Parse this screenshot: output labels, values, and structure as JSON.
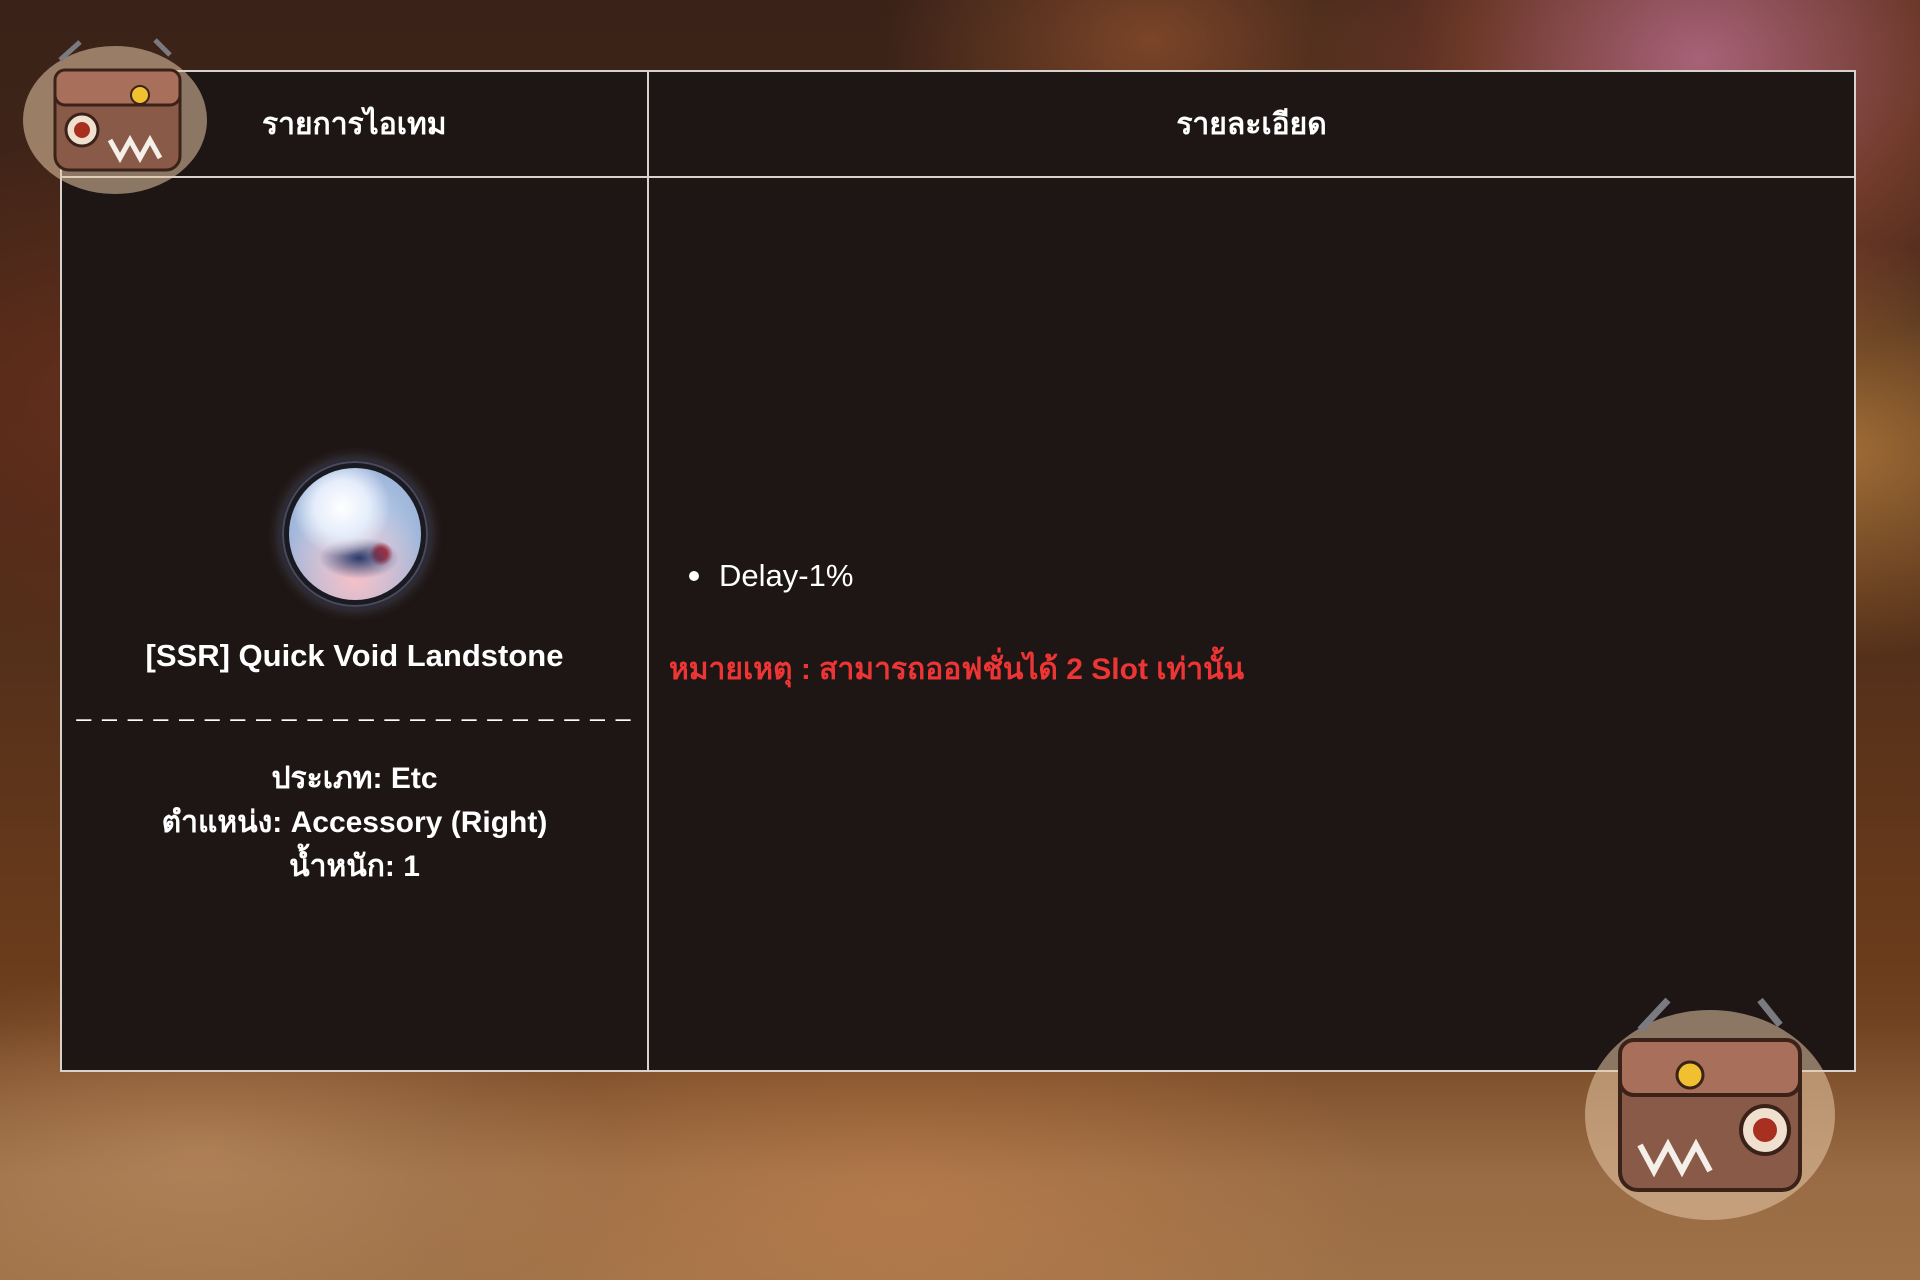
{
  "table": {
    "header_items": "รายการไอเทม",
    "header_details": "รายละเอียด"
  },
  "item": {
    "icon": "void-landstone-orb-icon",
    "name": "[SSR] Quick Void Landstone",
    "separator": "______________________",
    "type_line": "ประเภท: Etc",
    "position_line": "ตำแหน่ง: Accessory (Right)",
    "weight_line": "น้ำหนัก: 1"
  },
  "details": {
    "effects": [
      "Delay-1%"
    ],
    "note": "หมายเหตุ : สามารถออฟชั่นได้ 2 Slot เท่านั้น"
  },
  "decorations": {
    "top_left": "mimic-chest-icon",
    "bottom_right": "mimic-chest-icon"
  },
  "colors": {
    "panel": "#1e1614",
    "border": "#d8d2cc",
    "note": "#ee3535"
  }
}
